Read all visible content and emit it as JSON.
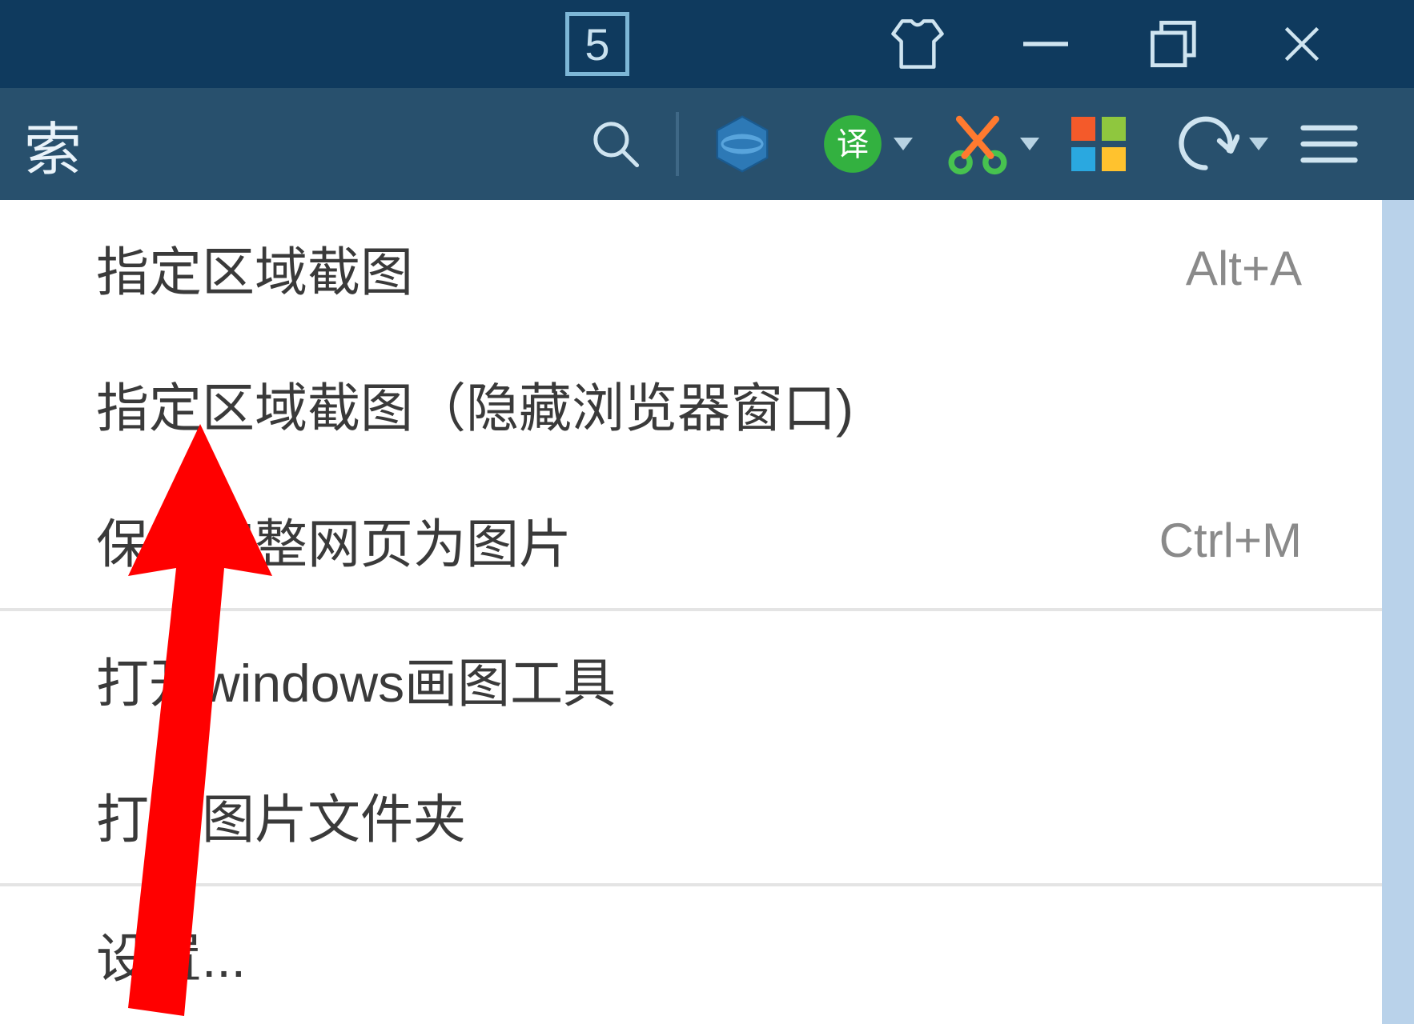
{
  "titlebar": {
    "badge": "5",
    "skin_icon": "skin-icon",
    "min_icon": "minimize-icon",
    "restore_icon": "restore-icon",
    "close_icon": "close-icon"
  },
  "toolbar": {
    "search_label": "索",
    "search_icon": "search-icon",
    "browser_icon": "browser-icon",
    "translate_badge": "译",
    "translate_icon": "translate-icon",
    "screenshot_icon": "scissors-icon",
    "tiles_icon": "tiles-icon",
    "undo_icon": "undo-icon",
    "menu_icon": "hamburger-icon"
  },
  "menu": {
    "items": [
      {
        "label": "指定区域截图",
        "shortcut": "Alt+A"
      },
      {
        "label": "指定区域截图（隐藏浏览器窗口)",
        "shortcut": ""
      },
      {
        "label": "保存完整网页为图片",
        "shortcut": "Ctrl+M"
      },
      {
        "label": "打开windows画图工具",
        "shortcut": ""
      },
      {
        "label": "打开图片文件夹",
        "shortcut": ""
      },
      {
        "label": "设置...",
        "shortcut": ""
      }
    ]
  },
  "annotation": {
    "arrow_color": "#ff0000"
  }
}
